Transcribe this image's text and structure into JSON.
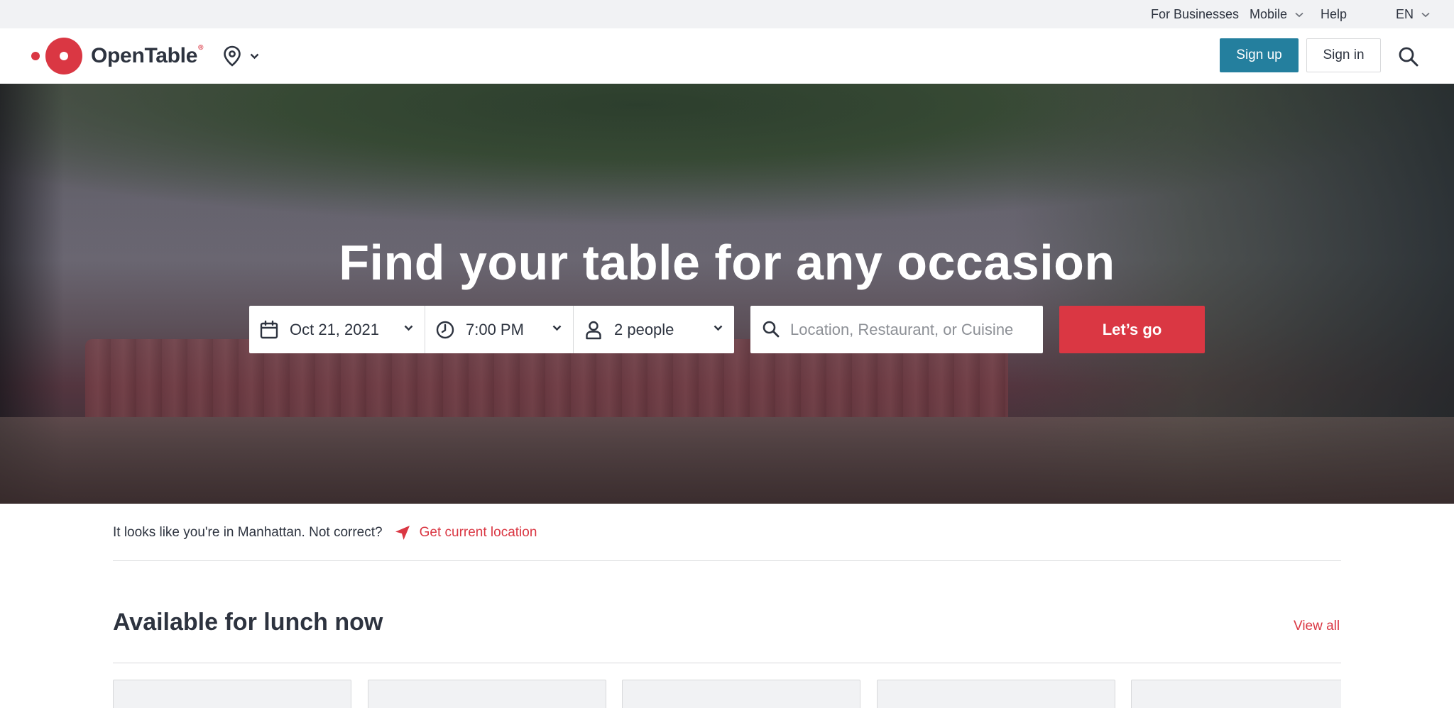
{
  "utility_bar": {
    "for_businesses": "For Businesses",
    "mobile": "Mobile",
    "help": "Help",
    "language": "EN"
  },
  "header": {
    "brand": "OpenTable",
    "brand_mark": "®",
    "sign_up": "Sign up",
    "sign_in": "Sign in",
    "icons": [
      "map-pin-icon",
      "chevron-down-icon",
      "search-icon"
    ]
  },
  "hero": {
    "title": "Find your table for any occasion",
    "date": "Oct 21, 2021",
    "time": "7:00 PM",
    "party": "2 people",
    "search_placeholder": "Location, Restaurant, or Cuisine",
    "search_value": "",
    "submit": "Let’s go",
    "icons": [
      "calendar-icon",
      "clock-icon",
      "person-icon",
      "search-icon"
    ]
  },
  "location_notice": {
    "text": "It looks like you're in Manhattan. Not correct?",
    "action": "Get current location"
  },
  "section": {
    "title": "Available for lunch now",
    "view_all": "View all"
  },
  "colors": {
    "brand_red": "#da3743",
    "signup_blue": "#247f9e",
    "text": "#2d333f",
    "utility_bg": "#f1f2f4"
  }
}
